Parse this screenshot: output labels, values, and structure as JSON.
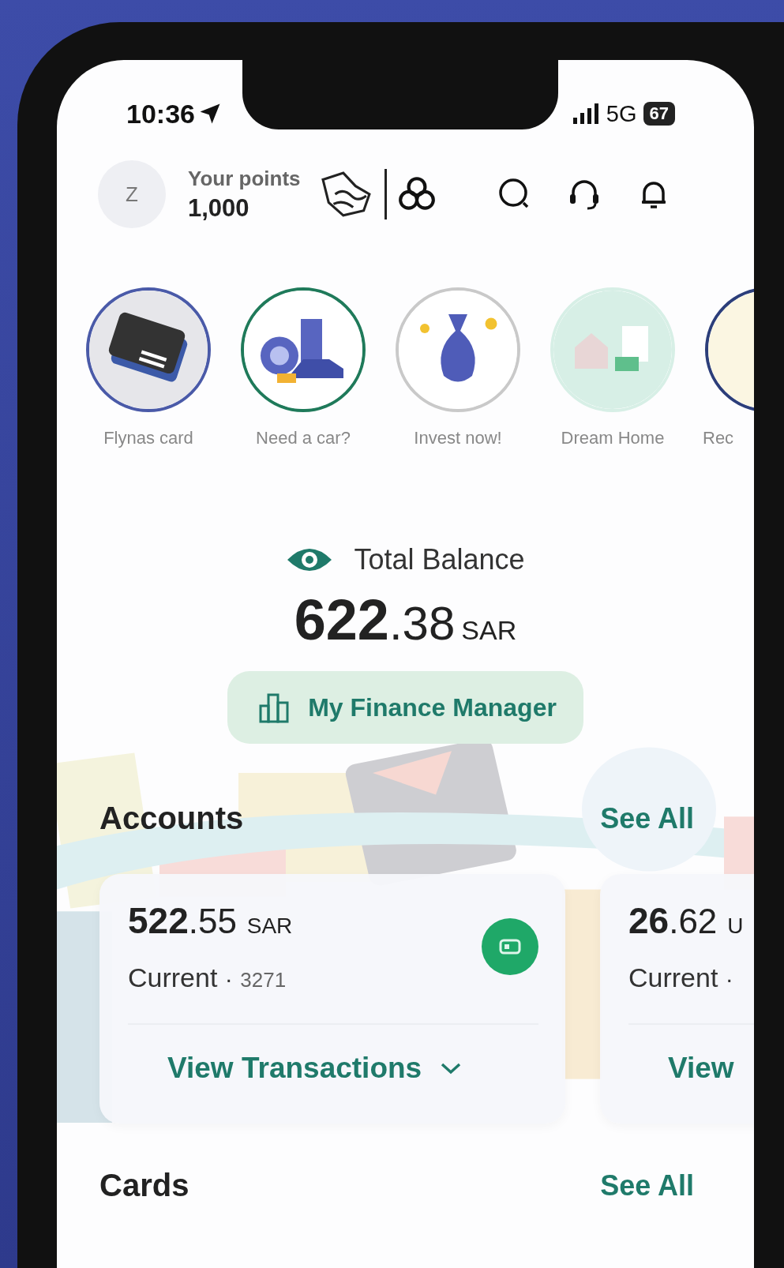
{
  "status_bar": {
    "time": "10:36",
    "network": "5G",
    "battery": "67"
  },
  "header": {
    "avatar": "Z",
    "points_label": "Your points",
    "points": "1,000"
  },
  "stories": [
    {
      "label": "Flynas card",
      "kind": "card",
      "color": "#4a5aa8"
    },
    {
      "label": "Need a car?",
      "kind": "car",
      "color": "#1f7a5a"
    },
    {
      "label": "Invest now!",
      "kind": "invest",
      "color": "#c9c9c9"
    },
    {
      "label": "Dream Home",
      "kind": "home",
      "color": "#d7efe6"
    },
    {
      "label": "Rec",
      "kind": "stripes",
      "color": "#2c3e7a"
    }
  ],
  "balance": {
    "label": "Total Balance",
    "whole": "622",
    "fraction": ".38",
    "currency": "SAR"
  },
  "finance_button": "My Finance Manager",
  "accounts": {
    "title": "Accounts",
    "see_all": "See All",
    "items": [
      {
        "whole": "522",
        "fraction": ".55",
        "currency": "SAR",
        "type": "Current",
        "separator": "·",
        "number": "3271",
        "action": "View Transactions"
      },
      {
        "whole": "26",
        "fraction": ".62",
        "currency": "U",
        "type": "Current",
        "separator": "·",
        "action": "View"
      }
    ]
  },
  "cards": {
    "title": "Cards",
    "see_all": "See All"
  }
}
